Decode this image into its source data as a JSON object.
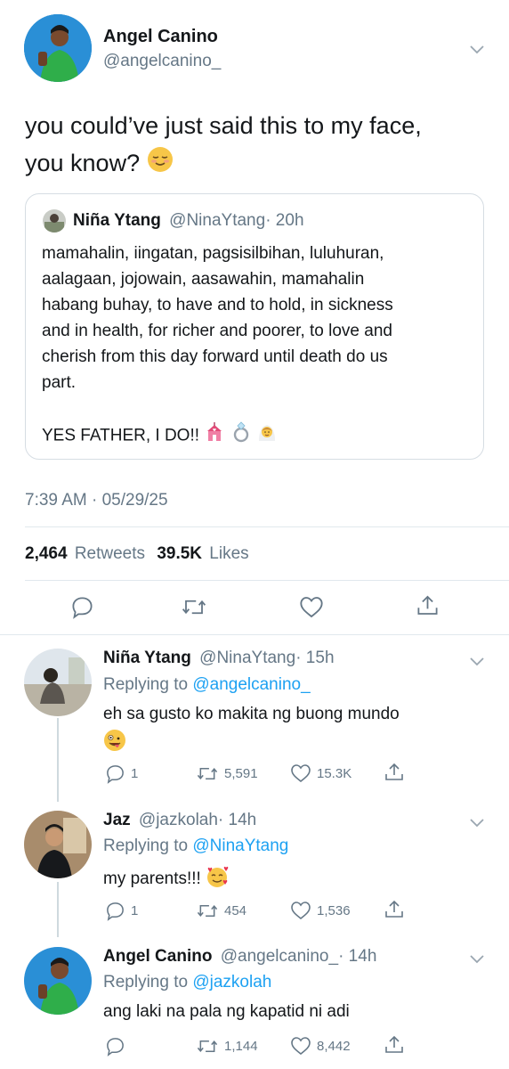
{
  "tweet": {
    "author_name": "Angel Canino",
    "author_handle": "@angelcanino_",
    "text_line1": "you could’ve just said this to my face,",
    "text_line2": "you know?",
    "quote": {
      "author_name": "Niña Ytang",
      "author_handle": "@NinaYtang",
      "age": "· 20h",
      "lines": [
        "mamahalin, iingatan, pagsisilbihan, luluhuran,",
        "aalagaan, jojowain, aasawahin, mamahalin",
        "habang buhay, to have and to hold, in sickness",
        "and in health, for richer and poorer, to love and",
        "cherish from this day forward until death do us",
        "part."
      ],
      "closing": "YES FATHER, I DO!!"
    },
    "timestamp": "7:39 AM · 05/29/25",
    "retweets_count": "2,464",
    "retweets_label": "Retweets",
    "likes_count": "39.5K",
    "likes_label": "Likes"
  },
  "replies": [
    {
      "author_name": "Niña Ytang",
      "author_handle": "@NinaYtang",
      "age": "· 15h",
      "replying_prefix": "Replying to",
      "replying_to": "@angelcanino_",
      "text": "eh sa gusto ko makita ng buong mundo",
      "replies": "1",
      "retweets": "5,591",
      "likes": "15.3K"
    },
    {
      "author_name": "Jaz",
      "author_handle": "@jazkolah",
      "age": "· 14h",
      "replying_prefix": "Replying to",
      "replying_to": "@NinaYtang",
      "text": "my parents!!!",
      "replies": "1",
      "retweets": "454",
      "likes": "1,536"
    },
    {
      "author_name": "Angel Canino",
      "author_handle": "@angelcanino_",
      "age": "· 14h",
      "replying_prefix": "Replying to",
      "replying_to": "@jazkolah",
      "text": "ang laki na pala ng kapatid ni adi",
      "replies": "",
      "retweets": "1,144",
      "likes": "8,442"
    }
  ],
  "colors": {
    "link": "#1da1f2",
    "muted": "#657786",
    "border": "#e1e8ed",
    "text": "#14171a"
  }
}
